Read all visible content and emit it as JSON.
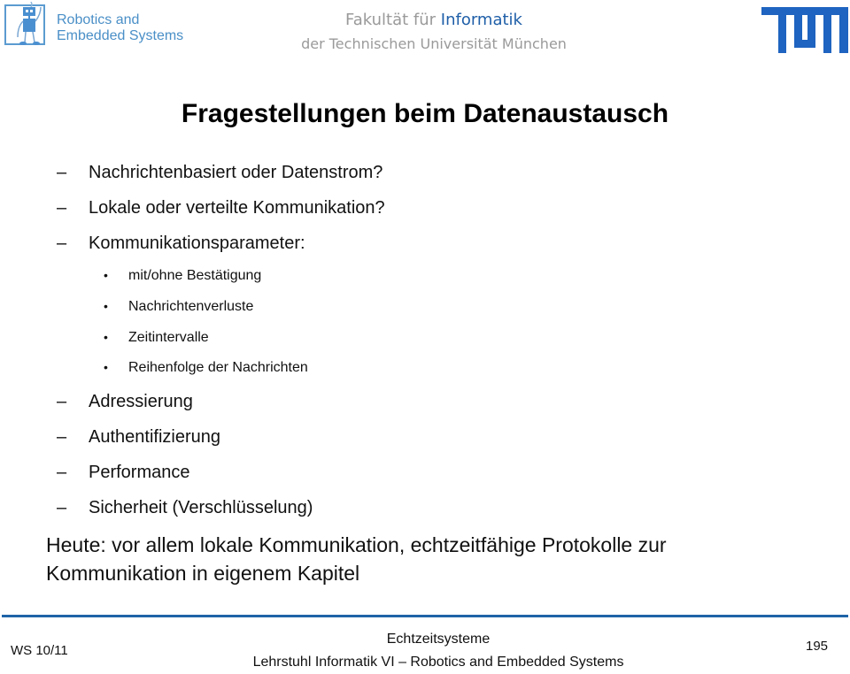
{
  "header": {
    "logo_left": {
      "line1": "Robotics and",
      "line2": "Embedded Systems",
      "icon": "robot-icon",
      "color": "#4a8fc7"
    },
    "faculty": {
      "prefix": "Fakultät für ",
      "accent": "Informatik",
      "line2": "der Technischen Universität München",
      "accent_color": "#1f5fa8",
      "text_color": "#9a9a9a"
    },
    "logo_right": {
      "name": "TUM",
      "icon": "tum-logo-icon",
      "color": "#1f64c0"
    }
  },
  "slide": {
    "title": "Fragestellungen beim Datenaustausch",
    "items": [
      {
        "type": "dash",
        "text": "Nachrichtenbasiert oder Datenstrom?"
      },
      {
        "type": "dash",
        "text": "Lokale oder verteilte Kommunikation?"
      },
      {
        "type": "dash",
        "text": "Kommunikationsparameter:"
      },
      {
        "type": "bullet",
        "text": "mit/ohne Bestätigung"
      },
      {
        "type": "bullet",
        "text": "Nachrichtenverluste"
      },
      {
        "type": "bullet",
        "text": "Zeitintervalle"
      },
      {
        "type": "bullet",
        "text": "Reihenfolge der Nachrichten"
      },
      {
        "type": "dash",
        "text": "Adressierung"
      },
      {
        "type": "dash",
        "text": "Authentifizierung"
      },
      {
        "type": "dash",
        "text": "Performance"
      },
      {
        "type": "dash",
        "text": "Sicherheit (Verschlüsselung)"
      }
    ],
    "dash_glyph": "–",
    "bullet_glyph": "•",
    "summary_line1": "Heute: vor allem lokale Kommunikation, echtzeitfähige Protokolle zur",
    "summary_line2": "Kommunikation in eigenem Kapitel"
  },
  "footer": {
    "semester": "WS 10/11",
    "course": "Echtzeitsysteme",
    "chair": "Lehrstuhl Informatik VI – Robotics and Embedded Systems",
    "page_number": "195",
    "rule_color": "#1f64a8"
  }
}
